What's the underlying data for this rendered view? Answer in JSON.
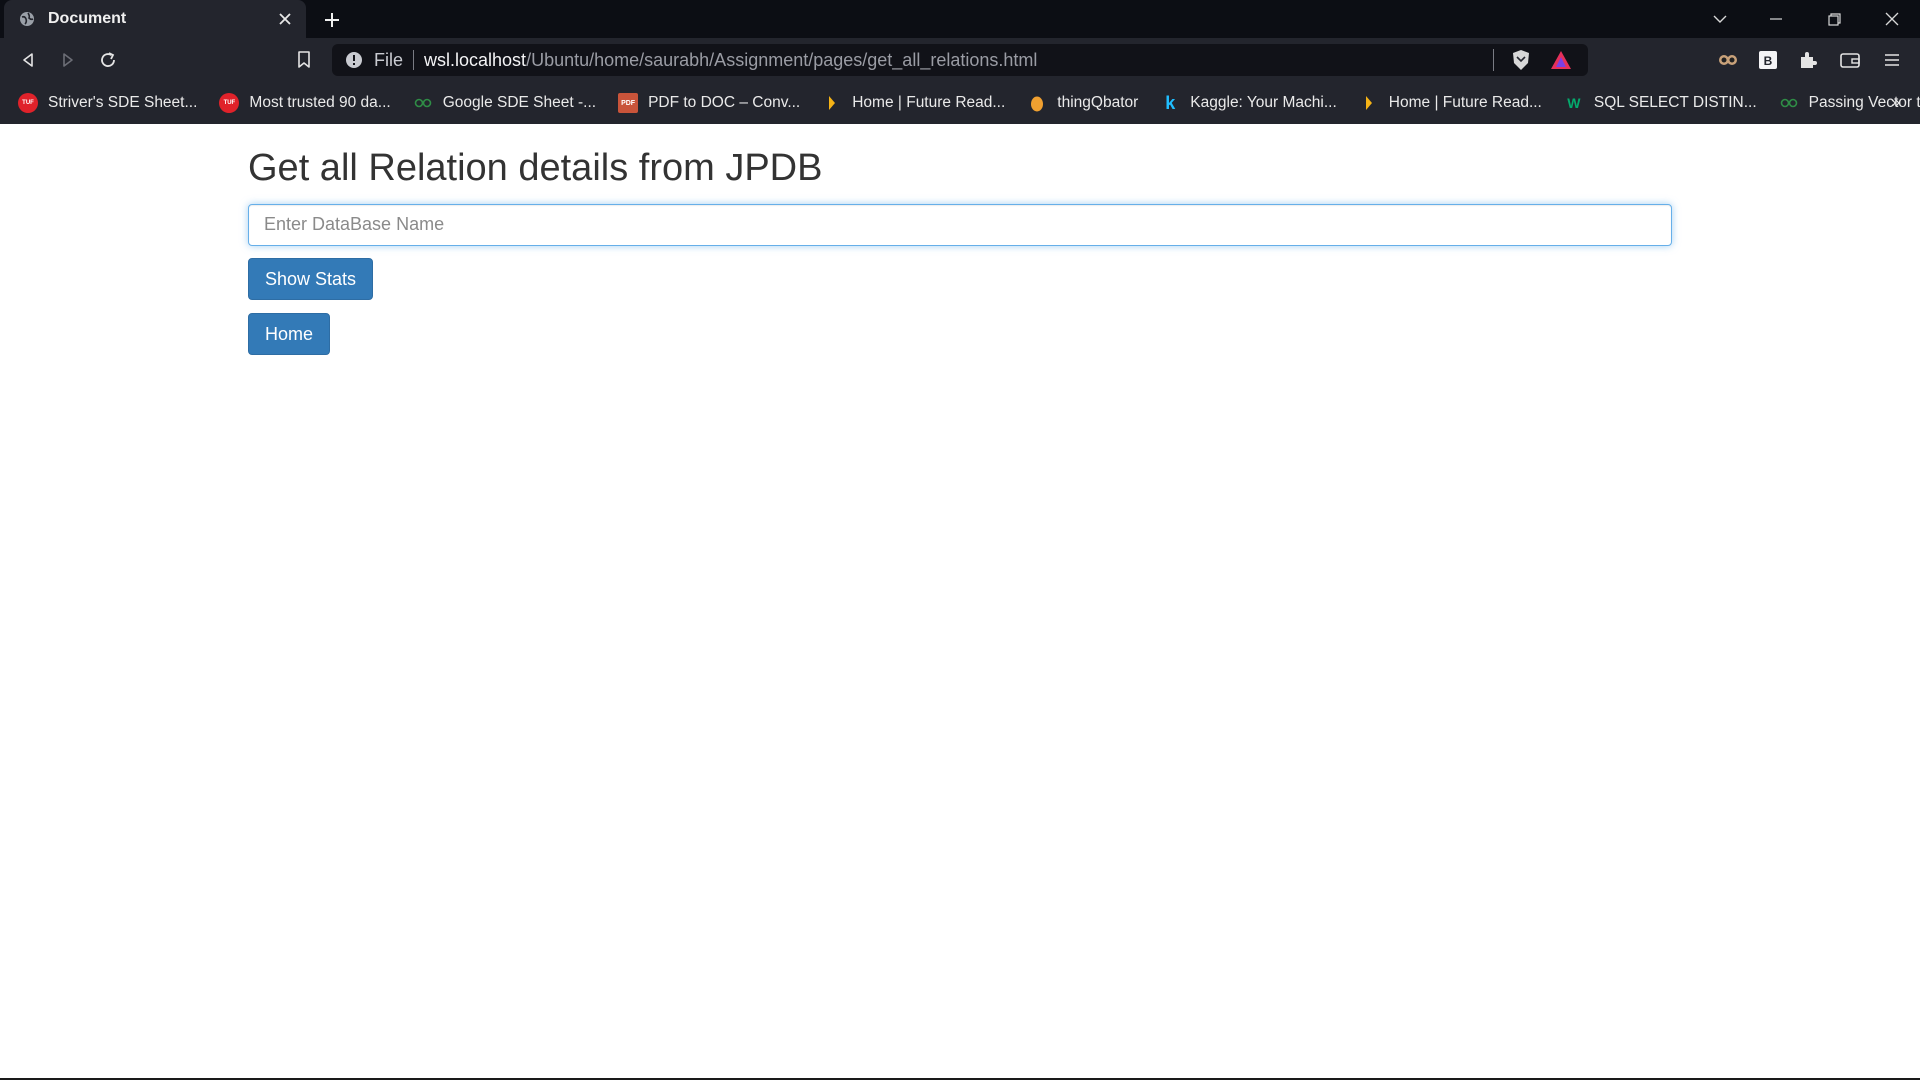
{
  "browser": {
    "tab": {
      "title": "Document"
    },
    "address_bar": {
      "scheme_label": "File",
      "host": "wsl.localhost",
      "path": "/Ubuntu/home/saurabh/Assignment/pages/get_all_relations.html"
    },
    "bookmarks": [
      {
        "label": "Striver's SDE Sheet...",
        "icon": "tuf-icon",
        "color": "#e0222a",
        "badge": "TUF"
      },
      {
        "label": "Most trusted 90 da...",
        "icon": "tuf-icon",
        "color": "#e0222a",
        "badge": "TUF"
      },
      {
        "label": "Google SDE Sheet -...",
        "icon": "gfg-icon",
        "color": "#2f8d46",
        "badge": ""
      },
      {
        "label": "PDF to DOC – Conv...",
        "icon": "pdf-doc-icon",
        "color": "#c9543a",
        "badge": "PDF"
      },
      {
        "label": "Home | Future Read...",
        "icon": "future-read-icon",
        "color": "#f5b316",
        "badge": ""
      },
      {
        "label": "thingQbator",
        "icon": "egg-icon",
        "color": "#f0a030",
        "badge": ""
      },
      {
        "label": "Kaggle: Your Machi...",
        "icon": "kaggle-icon",
        "color": "#20beff",
        "badge": "k"
      },
      {
        "label": "Home | Future Read...",
        "icon": "future-read-icon",
        "color": "#f5b316",
        "badge": ""
      },
      {
        "label": "SQL SELECT DISTIN...",
        "icon": "w3schools-icon",
        "color": "#04aa6d",
        "badge": "W"
      },
      {
        "label": "Passing Vector to a...",
        "icon": "gfg-icon",
        "color": "#2f8d46",
        "badge": ""
      }
    ],
    "bookmarks_overflow": "»"
  },
  "page": {
    "title": "Get all Relation details from JPDB",
    "db_input": {
      "placeholder": "Enter DataBase Name",
      "value": ""
    },
    "show_stats_label": "Show Stats",
    "home_label": "Home"
  },
  "colors": {
    "primary_button": "#337ab7",
    "input_focus": "#66afe9",
    "chrome_dark": "#23252d",
    "tabstrip": "#0c0e14"
  }
}
